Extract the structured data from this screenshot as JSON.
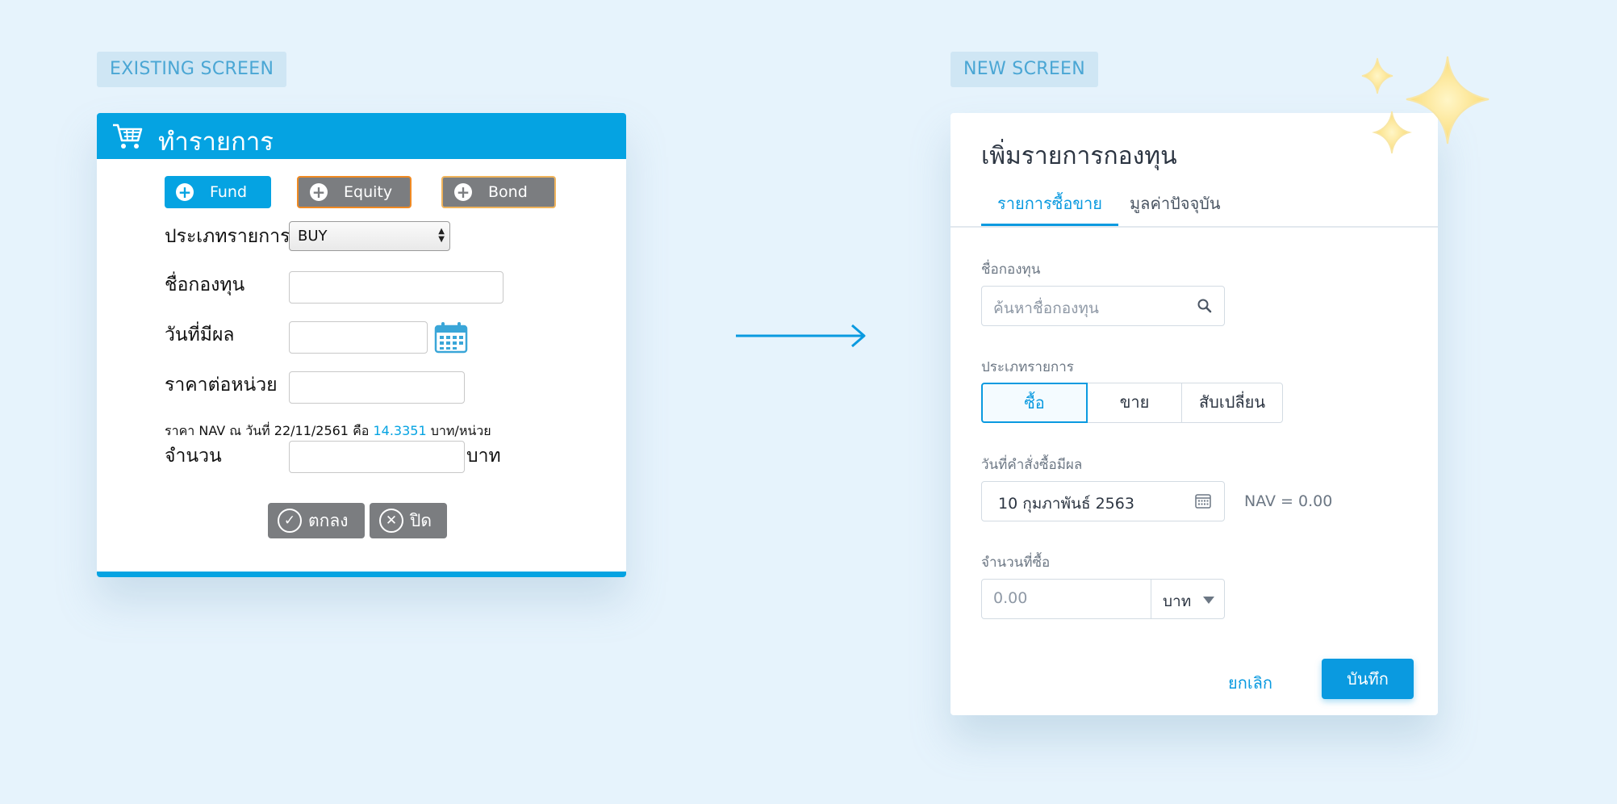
{
  "existing": {
    "tag": "EXISTING SCREEN",
    "title": "ทำรายการ",
    "buttons": {
      "fund": "Fund",
      "equity": "Equity",
      "bond": "Bond"
    },
    "type_label": "ประเภทรายการ",
    "type_value": "BUY",
    "fund_name_label": "ชื่อกองทุน",
    "effective_date_label": "วันที่มีผล",
    "unit_price_label": "ราคาต่อหน่วย",
    "nav_prefix": "ราคา NAV ณ วันที่ 22/11/2561 คือ",
    "nav_value": "14.3351",
    "nav_suffix": "บาท/หน่วย",
    "amount_label": "จำนวน",
    "amount_unit": "บาท",
    "ok_label": "ตกลง",
    "close_label": "ปิด"
  },
  "new": {
    "tag": "NEW SCREEN",
    "title": "เพิ่มรายการกองทุน",
    "tabs": [
      "รายการซื้อขาย",
      "มูลค่าปัจจุบัน"
    ],
    "fund_name_label": "ชื่อกองทุน",
    "fund_name_placeholder": "ค้นหาชื่อกองทุน",
    "type_label": "ประเภทรายการ",
    "type_options": [
      "ซื้อ",
      "ขาย",
      "สับเปลี่ยน"
    ],
    "date_label": "วันที่คำสั่งซื้อมีผล",
    "date_value": "10 กุมภาพันธ์ 2563",
    "nav_text": "NAV = 0.00",
    "amount_label": "จำนวนที่ซื้อ",
    "amount_value": "0.00",
    "amount_unit": "บาท",
    "cancel_label": "ยกเลิก",
    "save_label": "บันทึก"
  },
  "colors": {
    "old_header": "#05a3e2",
    "fund_button": "#05a3e2",
    "gray_button": "#7b7d80",
    "highlight_border": "#f08a23",
    "new_accent": "#0a9ae0",
    "background": "#e6f3fc",
    "sparkle": "#fbe38a"
  },
  "icons": [
    "cart-icon",
    "plus-icon",
    "calendar-icon",
    "check-circle-icon",
    "close-circle-icon",
    "arrow-right-icon",
    "search-icon",
    "chevron-down-icon",
    "sparkle-icon"
  ]
}
